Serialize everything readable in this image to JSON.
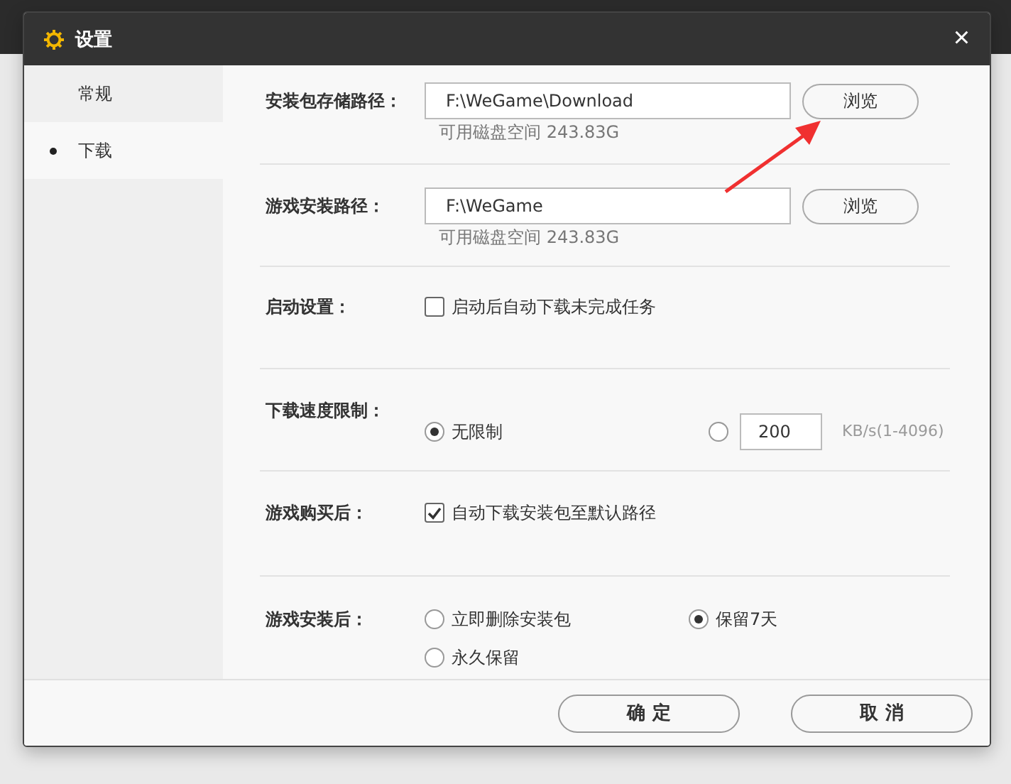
{
  "window": {
    "title": "设置",
    "close": "×"
  },
  "sidebar": {
    "items": [
      {
        "label": "常规",
        "selected": false
      },
      {
        "label": "下载",
        "selected": true
      }
    ]
  },
  "sections": [
    {
      "kind": "path",
      "label": "安装包存储路径：",
      "value": "F:\\WeGame\\Download",
      "button": "浏览",
      "note": "可用磁盘空间 243.83G"
    },
    {
      "kind": "path",
      "label": "游戏安装路径：",
      "value": "F:\\WeGame",
      "button": "浏览",
      "note": "可用磁盘空间 243.83G"
    },
    {
      "kind": "checkbox",
      "label": "启动设置：",
      "options": [
        {
          "text": "启动后自动下载未完成任务",
          "checked": false
        }
      ]
    },
    {
      "kind": "radio",
      "label": "下载速度限制：",
      "options": [
        {
          "text": "无限制",
          "selected": true
        },
        {
          "selected": false,
          "value": "200",
          "unit": "KB/s(1-4096)"
        }
      ]
    },
    {
      "kind": "checkbox",
      "label": "游戏购买后：",
      "options": [
        {
          "text": "自动下载安装包至默认路径",
          "checked": true
        }
      ]
    },
    {
      "kind": "radio",
      "label": "游戏安装后：",
      "options": [
        {
          "text": "立即删除安装包",
          "selected": false
        },
        {
          "text": "保留7天",
          "selected": true
        },
        {
          "text": "永久保留",
          "selected": false
        }
      ]
    }
  ],
  "buttons": [
    "确 定",
    "取 消"
  ]
}
